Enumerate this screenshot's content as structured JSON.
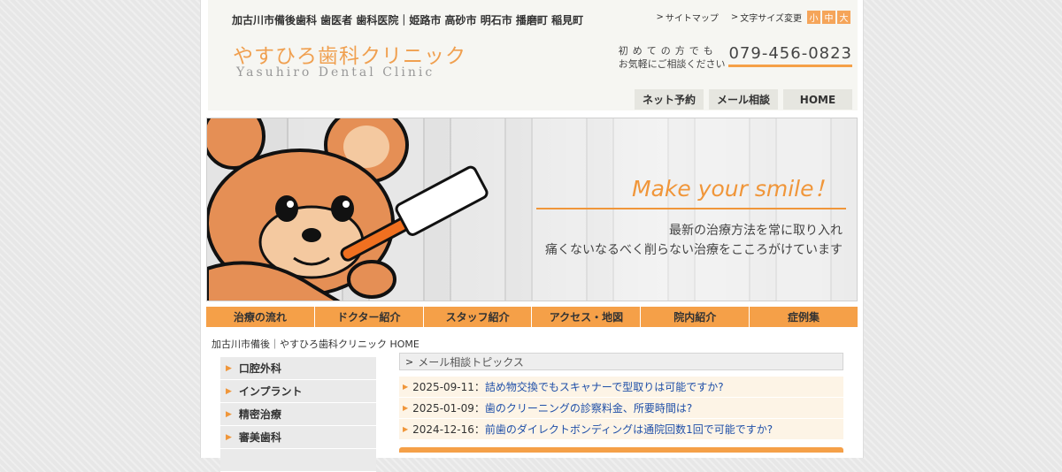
{
  "header": {
    "tagline": "加古川市備後歯科 歯医者 歯科医院｜姫路市 高砂市 明石市 播磨町 稲見町",
    "sitemap": "サイトマップ",
    "font_size_label": "文字サイズ変更",
    "font_sizes": [
      "小",
      "中",
      "大"
    ],
    "logo_jp": "やすひろ歯科クリニック",
    "logo_en": "Yasuhiro Dental Clinic",
    "contact_line1": "初めての方でも",
    "contact_line2": "お気軽にご相談ください",
    "phone": "079-456-0823",
    "buttons": [
      "ネット予約",
      "メール相談",
      "HOME"
    ]
  },
  "hero": {
    "slogan": "Make your smile！",
    "line1": "最新の治療方法を常に取り入れ",
    "line2": "痛くないなるべく削らない治療をこころがけています"
  },
  "nav": [
    "治療の流れ",
    "ドクター紹介",
    "スタッフ紹介",
    "アクセス・地図",
    "院内紹介",
    "症例集"
  ],
  "breadcrumb": "加古川市備後｜やすひろ歯科クリニック HOME",
  "side_menu": [
    "口腔外科",
    "インプラント",
    "精密治療",
    "審美歯科"
  ],
  "topics": {
    "heading": "メール相談トピックス",
    "items": [
      {
        "date": "2025-09-11：",
        "title": "詰め物交換でもスキャナーで型取りは可能ですか?"
      },
      {
        "date": "2025-01-09：",
        "title": "歯のクリーニングの診察料金、所要時間は?"
      },
      {
        "date": "2024-12-16：",
        "title": "前歯のダイレクトボンディングは通院回数1回で可能ですか?"
      }
    ]
  },
  "colors": {
    "accent": "#f5a048",
    "link": "#1f4fa8",
    "logo": "#f0a050"
  }
}
